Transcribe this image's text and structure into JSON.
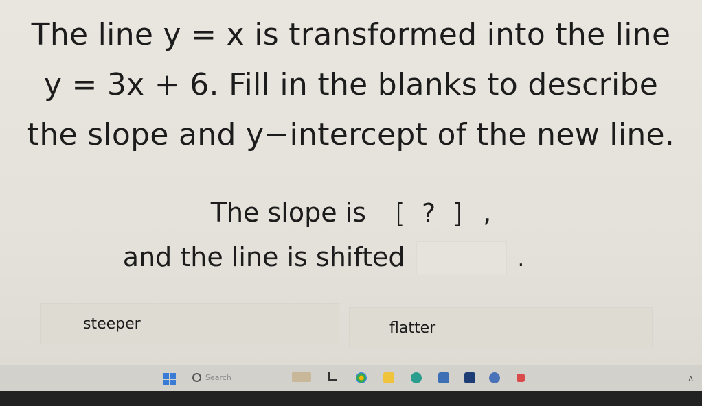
{
  "question": {
    "line1": "The line y = x is transformed into the line",
    "line2": "y = 3x + 6. Fill in the blanks to describe",
    "line3": "the slope and y−intercept of the new line."
  },
  "sentence": {
    "part1": "The slope is",
    "blank1": "?",
    "after1": ",",
    "part2": "and the line is shifted",
    "end": "."
  },
  "choices": [
    {
      "label": "steeper"
    },
    {
      "label": "flatter"
    }
  ],
  "taskbar": {
    "search_placeholder": "Search",
    "icons": [
      "windows-icon",
      "search-icon",
      "weather-icon",
      "files-icon",
      "chrome-icon",
      "folder-icon",
      "edge-icon",
      "store-icon",
      "lenovo-icon",
      "app-icon",
      "record-icon",
      "chevron-up-icon"
    ]
  }
}
